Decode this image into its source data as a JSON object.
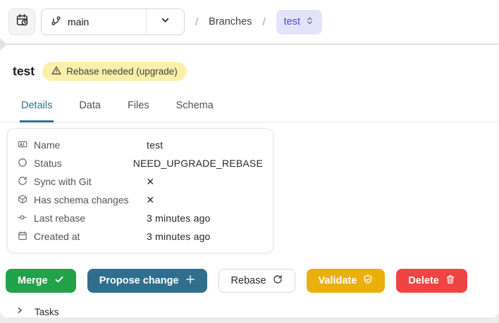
{
  "topbar": {
    "history_button_icon": "calendar-clock-icon",
    "branch_selector": {
      "icon": "git-branch-icon",
      "value": "main",
      "chevron": "chevron-down-icon"
    },
    "breadcrumb": {
      "sep": "/",
      "section": "Branches",
      "current": "test",
      "current_icon": "chevrons-up-down-icon"
    }
  },
  "header": {
    "title": "test",
    "badge": {
      "icon": "warning-triangle-icon",
      "label": "Rebase needed (upgrade)"
    }
  },
  "tabs": [
    {
      "label": "Details",
      "active": true
    },
    {
      "label": "Data",
      "active": false
    },
    {
      "label": "Files",
      "active": false
    },
    {
      "label": "Schema",
      "active": false
    }
  ],
  "details": {
    "rows": [
      {
        "icon": "name-field-icon",
        "label": "Name",
        "value": "test"
      },
      {
        "icon": "status-circle-icon",
        "label": "Status",
        "value": "NEED_UPGRADE_REBASE"
      },
      {
        "icon": "sync-icon",
        "label": "Sync with Git",
        "value": "×"
      },
      {
        "icon": "schema-box-icon",
        "label": "Has schema changes",
        "value": "×"
      },
      {
        "icon": "git-commit-icon",
        "label": "Last rebase",
        "value": "3 minutes ago"
      },
      {
        "icon": "calendar-icon",
        "label": "Created at",
        "value": "3 minutes ago"
      }
    ]
  },
  "actions": {
    "merge": {
      "label": "Merge",
      "icon": "check-icon",
      "color": "#21a24b"
    },
    "propose": {
      "label": "Propose change",
      "icon": "plus-icon",
      "color": "#306e8e"
    },
    "rebase": {
      "label": "Rebase",
      "icon": "refresh-icon",
      "color": "#ffffff"
    },
    "validate": {
      "label": "Validate",
      "icon": "shield-check-icon",
      "color": "#eab00a"
    },
    "delete": {
      "label": "Delete",
      "icon": "trash-icon",
      "color": "#ef4444"
    }
  },
  "tasks": {
    "label": "Tasks",
    "icon": "chevron-right-icon"
  },
  "colors": {
    "accent_teal": "#35718f",
    "badge_bg": "#fbf0a9",
    "breadcrumb_pill_bg": "#e3e4fa",
    "breadcrumb_pill_text": "#4f46e5",
    "merge_green": "#21a24b",
    "validate_amber": "#eab00a",
    "delete_red": "#ef4444"
  }
}
